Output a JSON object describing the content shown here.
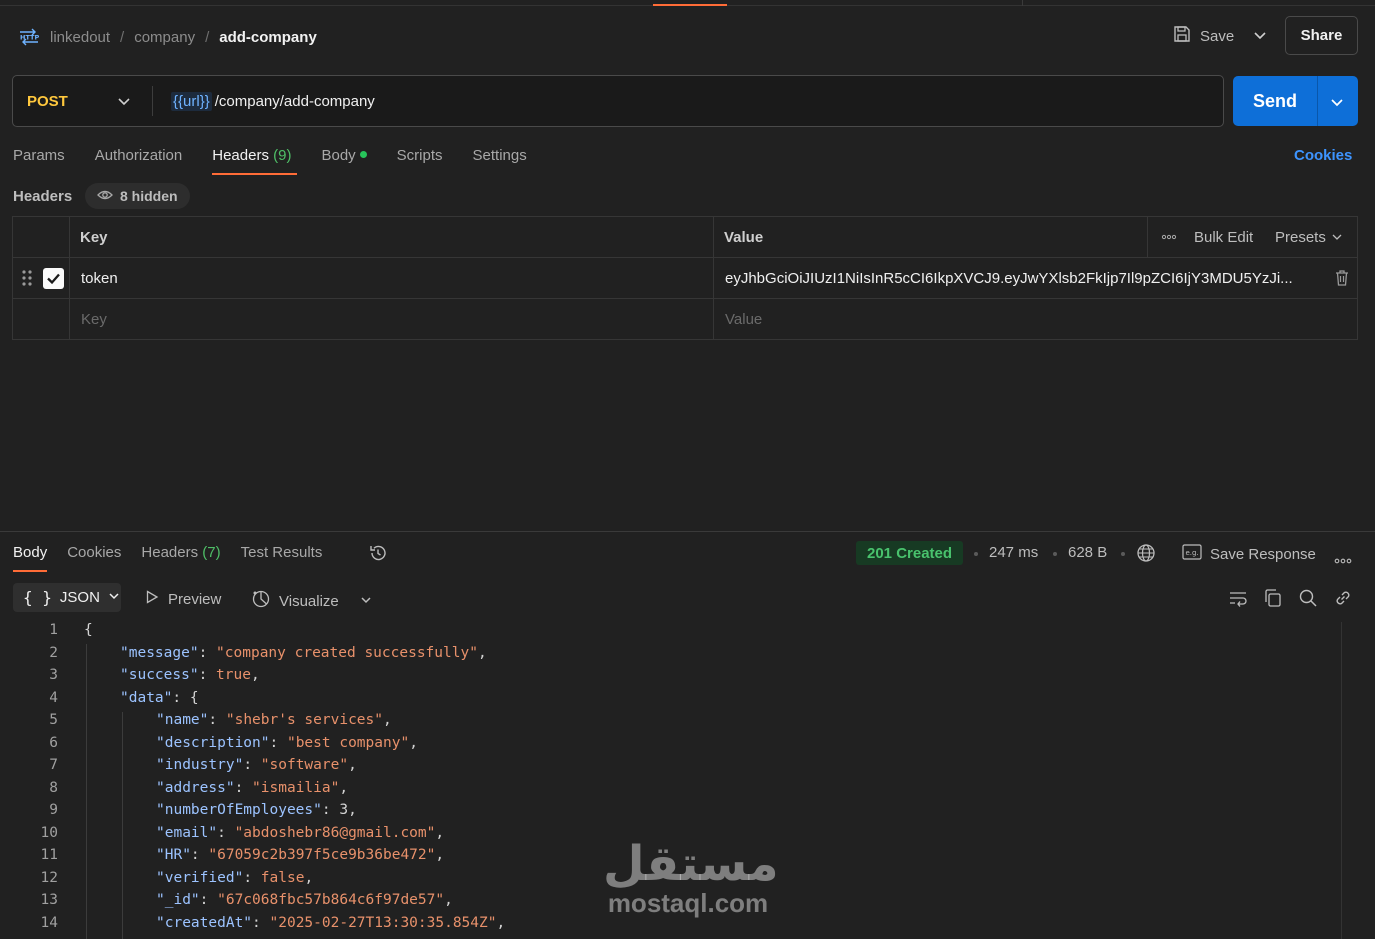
{
  "breadcrumb": {
    "items": [
      "linkedout",
      "company"
    ],
    "current": "add-company",
    "separator": "/"
  },
  "toolbar": {
    "save_label": "Save",
    "share_label": "Share"
  },
  "request": {
    "method": "POST",
    "url_variable": "{{url}}",
    "url_path": "/company/add-company",
    "send_label": "Send"
  },
  "request_tabs": {
    "params": "Params",
    "authorization": "Authorization",
    "headers": "Headers",
    "headers_count": "(9)",
    "body": "Body",
    "scripts": "Scripts",
    "settings": "Settings",
    "cookies": "Cookies"
  },
  "headers_section": {
    "title": "Headers",
    "hidden_label": "8 hidden",
    "col_key": "Key",
    "col_value": "Value",
    "bulk_edit": "Bulk Edit",
    "presets": "Presets",
    "rows": [
      {
        "key": "token",
        "value": "eyJhbGciOiJIUzI1NiIsInR5cCI6IkpXVCJ9.eyJwYXlsb2FkIjp7Il9pZCI6IjY3MDU5YzJi...",
        "checked": true
      }
    ],
    "placeholder_key": "Key",
    "placeholder_value": "Value"
  },
  "response": {
    "tabs": {
      "body": "Body",
      "cookies": "Cookies",
      "headers": "Headers",
      "headers_count": "(7)",
      "test_results": "Test Results"
    },
    "status": "201 Created",
    "time": "247 ms",
    "size": "628 B",
    "save_response": "Save Response",
    "format": "JSON",
    "preview": "Preview",
    "visualize": "Visualize",
    "code_lines": [
      {
        "n": "1",
        "indent": 0,
        "tokens": [
          [
            "p",
            "{"
          ]
        ]
      },
      {
        "n": "2",
        "indent": 1,
        "tokens": [
          [
            "k",
            "\"message\""
          ],
          [
            "p",
            ": "
          ],
          [
            "s",
            "\"company created successfully\""
          ],
          [
            "p",
            ","
          ]
        ]
      },
      {
        "n": "3",
        "indent": 1,
        "tokens": [
          [
            "k",
            "\"success\""
          ],
          [
            "p",
            ": "
          ],
          [
            "b",
            "true"
          ],
          [
            "p",
            ","
          ]
        ]
      },
      {
        "n": "4",
        "indent": 1,
        "tokens": [
          [
            "k",
            "\"data\""
          ],
          [
            "p",
            ": {"
          ]
        ]
      },
      {
        "n": "5",
        "indent": 2,
        "tokens": [
          [
            "k",
            "\"name\""
          ],
          [
            "p",
            ": "
          ],
          [
            "s",
            "\"shebr's services\""
          ],
          [
            "p",
            ","
          ]
        ]
      },
      {
        "n": "6",
        "indent": 2,
        "tokens": [
          [
            "k",
            "\"description\""
          ],
          [
            "p",
            ": "
          ],
          [
            "s",
            "\"best company\""
          ],
          [
            "p",
            ","
          ]
        ]
      },
      {
        "n": "7",
        "indent": 2,
        "tokens": [
          [
            "k",
            "\"industry\""
          ],
          [
            "p",
            ": "
          ],
          [
            "s",
            "\"software\""
          ],
          [
            "p",
            ","
          ]
        ]
      },
      {
        "n": "8",
        "indent": 2,
        "tokens": [
          [
            "k",
            "\"address\""
          ],
          [
            "p",
            ": "
          ],
          [
            "s",
            "\"ismailia\""
          ],
          [
            "p",
            ","
          ]
        ]
      },
      {
        "n": "9",
        "indent": 2,
        "tokens": [
          [
            "k",
            "\"numberOfEmployees\""
          ],
          [
            "p",
            ": 3,"
          ]
        ]
      },
      {
        "n": "10",
        "indent": 2,
        "tokens": [
          [
            "k",
            "\"email\""
          ],
          [
            "p",
            ": "
          ],
          [
            "s",
            "\"abdoshebr86@gmail.com\""
          ],
          [
            "p",
            ","
          ]
        ]
      },
      {
        "n": "11",
        "indent": 2,
        "tokens": [
          [
            "k",
            "\"HR\""
          ],
          [
            "p",
            ": "
          ],
          [
            "s",
            "\"67059c2b397f5ce9b36be472\""
          ],
          [
            "p",
            ","
          ]
        ]
      },
      {
        "n": "12",
        "indent": 2,
        "tokens": [
          [
            "k",
            "\"verified\""
          ],
          [
            "p",
            ": "
          ],
          [
            "b",
            "false"
          ],
          [
            "p",
            ","
          ]
        ]
      },
      {
        "n": "13",
        "indent": 2,
        "tokens": [
          [
            "k",
            "\"_id\""
          ],
          [
            "p",
            ": "
          ],
          [
            "s",
            "\"67c068fbc57b864c6f97de57\""
          ],
          [
            "p",
            ","
          ]
        ]
      },
      {
        "n": "14",
        "indent": 2,
        "tokens": [
          [
            "k",
            "\"createdAt\""
          ],
          [
            "p",
            ": "
          ],
          [
            "s",
            "\"2025-02-27T13:30:35.854Z\""
          ],
          [
            "p",
            ","
          ]
        ]
      }
    ]
  },
  "watermark": {
    "arabic": "مستقل",
    "latin": "mostaql.com"
  },
  "colors": {
    "accent": "#ff6c37",
    "send": "#0e6fd8",
    "method": "#ffc83d",
    "status_ok": "#49c26d",
    "link": "#3d94ff"
  }
}
